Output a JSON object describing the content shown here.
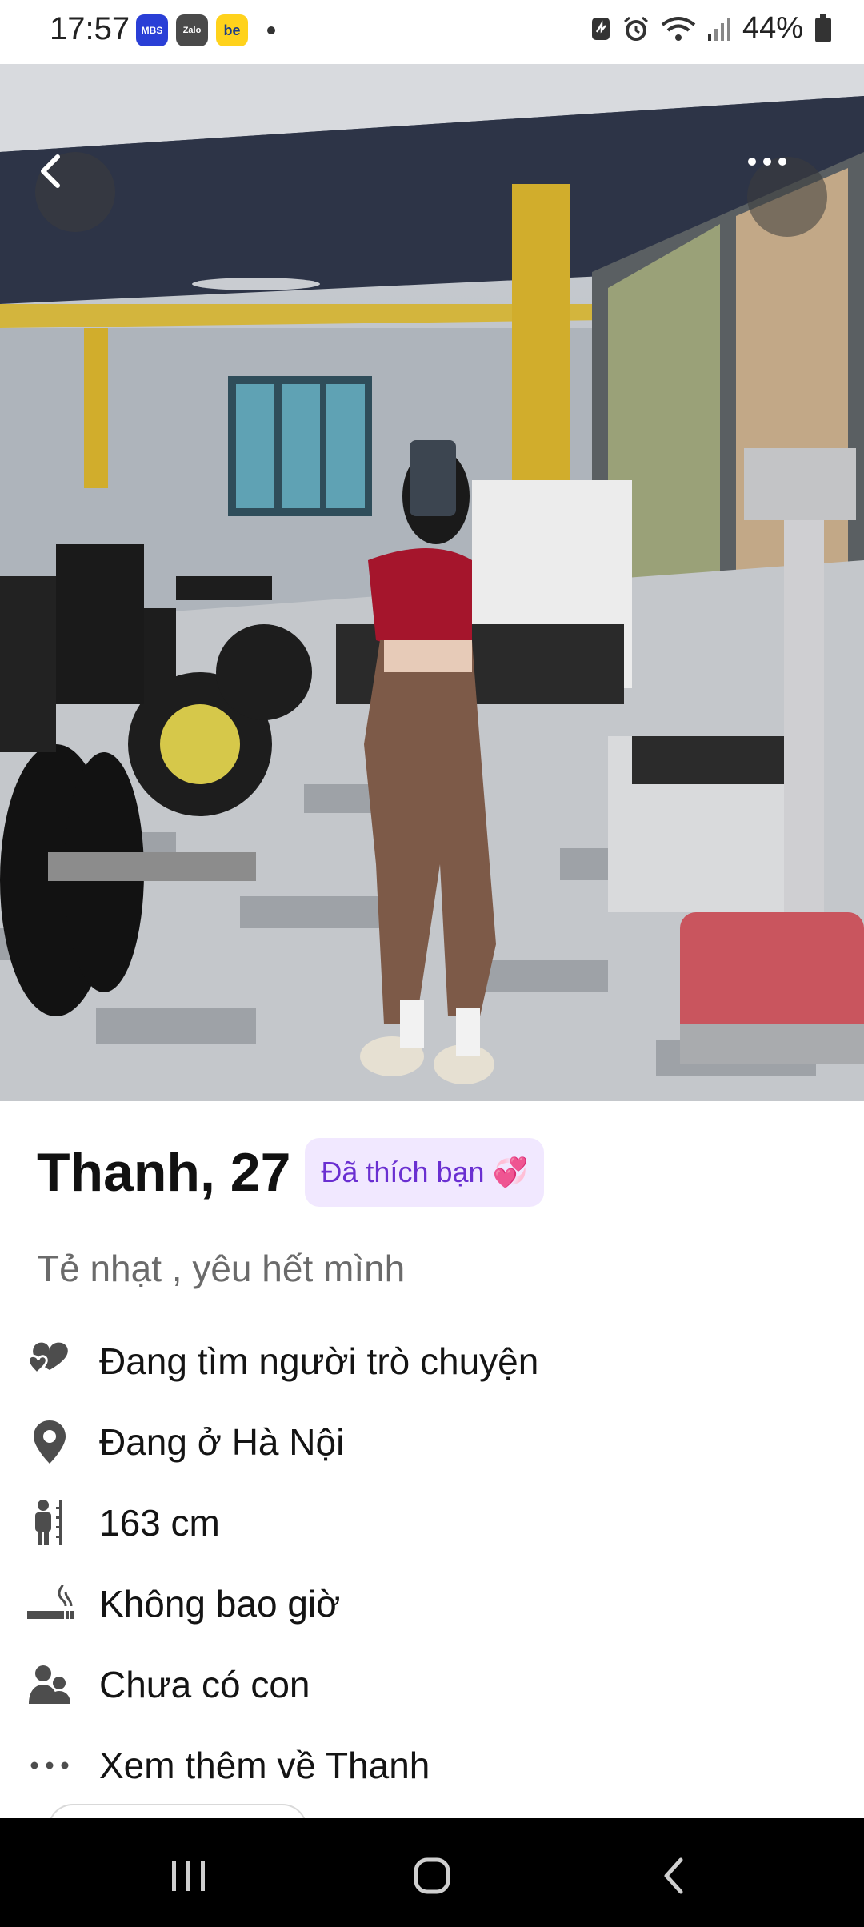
{
  "status_bar": {
    "time": "17:57",
    "apps": [
      "MBS",
      "Zalo",
      "be"
    ],
    "battery": "44%"
  },
  "photo": {
    "back_icon": "chevron-left-icon",
    "more_icon": "more-horizontal-icon"
  },
  "profile": {
    "name_age": "Thanh, 27",
    "liked_badge": "Đã thích bạn",
    "liked_emoji": "💞",
    "bio": "Tẻ nhạt , yêu hết mình",
    "attributes": [
      {
        "icon": "hearts-icon",
        "label": "Đang tìm người trò chuyện"
      },
      {
        "icon": "location-pin-icon",
        "label": "Đang ở Hà Nội"
      },
      {
        "icon": "height-icon",
        "label": "163 cm"
      },
      {
        "icon": "smoking-icon",
        "label": "Không bao giờ"
      },
      {
        "icon": "people-icon",
        "label": "Chưa có con"
      },
      {
        "icon": "more-horizontal-icon",
        "label": "Xem thêm về Thanh"
      }
    ]
  },
  "colors": {
    "badge_bg": "#f1e8ff",
    "badge_text": "#6a2fd1",
    "icon_gray": "#4d4d4d"
  }
}
